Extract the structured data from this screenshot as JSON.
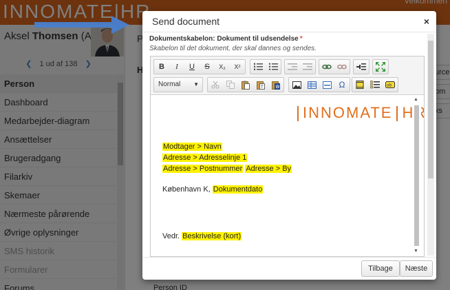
{
  "app": {
    "brand": "INNOMATE|HR",
    "top_right": "Velkommen"
  },
  "employee": {
    "first_name": "Aksel",
    "last_name": "Thomsen",
    "initials": "(AT)"
  },
  "pager": {
    "text": "1 ud af 138",
    "prev": "❮",
    "next": "❯"
  },
  "menu": [
    {
      "label": "Person",
      "state": "active"
    },
    {
      "label": "Dashboard",
      "state": "normal"
    },
    {
      "label": "Medarbejder-diagram",
      "state": "normal"
    },
    {
      "label": "Ansættelser",
      "state": "normal"
    },
    {
      "label": "Brugeradgang",
      "state": "normal"
    },
    {
      "label": "Filarkiv",
      "state": "normal"
    },
    {
      "label": "Skemaer",
      "state": "normal"
    },
    {
      "label": "Nærmeste pårørende",
      "state": "normal"
    },
    {
      "label": "Øvrige oplysninger",
      "state": "normal"
    },
    {
      "label": "SMS historik",
      "state": "muted"
    },
    {
      "label": "Formularer",
      "state": "muted"
    },
    {
      "label": "Forums",
      "state": "normal"
    }
  ],
  "right_panel": {
    "title": "P",
    "heading": "H",
    "field": "Person ID",
    "side_buttons": [
      "urce",
      "om",
      "ks"
    ]
  },
  "modal": {
    "title": "Send document",
    "close": "×",
    "field_label": "Dokumentskabelon: Dokument til udsendelse",
    "required_mark": "*",
    "field_hint": "Skabelon til det dokument, der skal dannes og sendes.",
    "format_select": "Normal",
    "toolbar": {
      "bold": "B",
      "italic": "I",
      "underline": "U",
      "strike": "S",
      "subscript": "X₂",
      "superscript": "X²"
    },
    "document": {
      "logo_left": "INNOMATE",
      "logo_right": "HR",
      "lines": [
        {
          "parts": [
            {
              "text": "Modtager > Navn",
              "highlight": true
            }
          ]
        },
        {
          "parts": [
            {
              "text": "Adresse > Adresselinje 1",
              "highlight": true
            }
          ]
        },
        {
          "parts": [
            {
              "text": "Adresse > Postnummer",
              "highlight": true
            },
            {
              "text": " ",
              "highlight": false
            },
            {
              "text": "Adresse > By",
              "highlight": true
            }
          ]
        },
        {
          "parts": [
            {
              "text": "København K, ",
              "highlight": false
            },
            {
              "text": "Dokumentdato",
              "highlight": true
            }
          ]
        },
        {
          "parts": [
            {
              "text": "Vedr. ",
              "highlight": false
            },
            {
              "text": "Beskrivelse (kort)",
              "highlight": true
            }
          ]
        }
      ]
    },
    "buttons": {
      "back": "Tilbage",
      "next": "Næste"
    }
  },
  "colors": {
    "brand_orange": "#d9661c",
    "highlight": "#fff200",
    "arrow_blue": "#4a7fcf"
  }
}
